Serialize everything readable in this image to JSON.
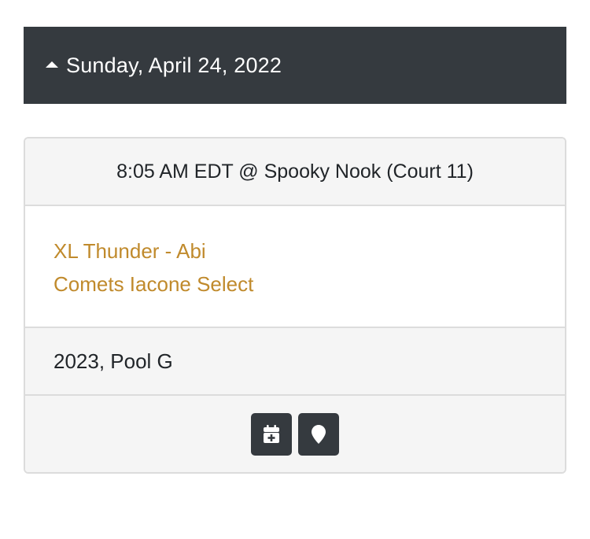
{
  "day": {
    "date_label": "Sunday, April 24, 2022",
    "caret_icon": "caret-up-icon"
  },
  "game": {
    "time_location": "8:05 AM EDT @ Spooky Nook (Court 11)",
    "teams": [
      "XL Thunder - Abi",
      "Comets Iacone Select"
    ],
    "pool": "2023, Pool G",
    "actions": [
      {
        "icon": "calendar-plus-icon"
      },
      {
        "icon": "map-marker-icon"
      }
    ]
  },
  "colors": {
    "header_bg": "#353a3f",
    "link": "#c08a2c",
    "card_muted_bg": "#f5f5f5",
    "border": "#dcdcdc"
  }
}
